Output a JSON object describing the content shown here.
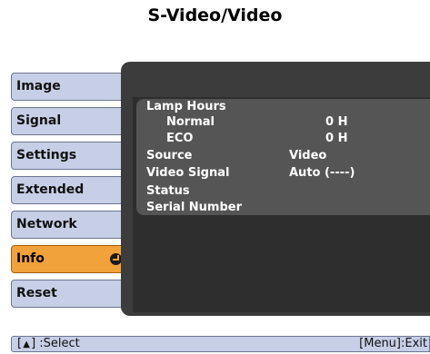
{
  "title": "S-Video/Video",
  "menu": {
    "items": [
      {
        "label": "Image"
      },
      {
        "label": "Signal"
      },
      {
        "label": "Settings"
      },
      {
        "label": "Extended"
      },
      {
        "label": "Network"
      },
      {
        "label": "Info",
        "selected": true
      },
      {
        "label": "Reset"
      }
    ],
    "accent_color": "#f2a23a",
    "item_color": "#c7cfe6"
  },
  "info": {
    "lamp_hours_label": "Lamp Hours",
    "normal_label": "Normal",
    "normal_value": "0 H",
    "eco_label": "ECO",
    "eco_value": "0 H",
    "source_label": "Source",
    "source_value": "Video",
    "video_signal_label": "Video Signal",
    "video_signal_value": "Auto (----)",
    "status_label": "Status",
    "serial_number_label": "Serial Number"
  },
  "statusbar": {
    "select_prefix": "[",
    "select_suffix": "] :Select",
    "exit_text": "[Menu]:Exit"
  },
  "icons": {
    "enter": "enter-icon",
    "updown": "up-down-arrows-icon"
  }
}
